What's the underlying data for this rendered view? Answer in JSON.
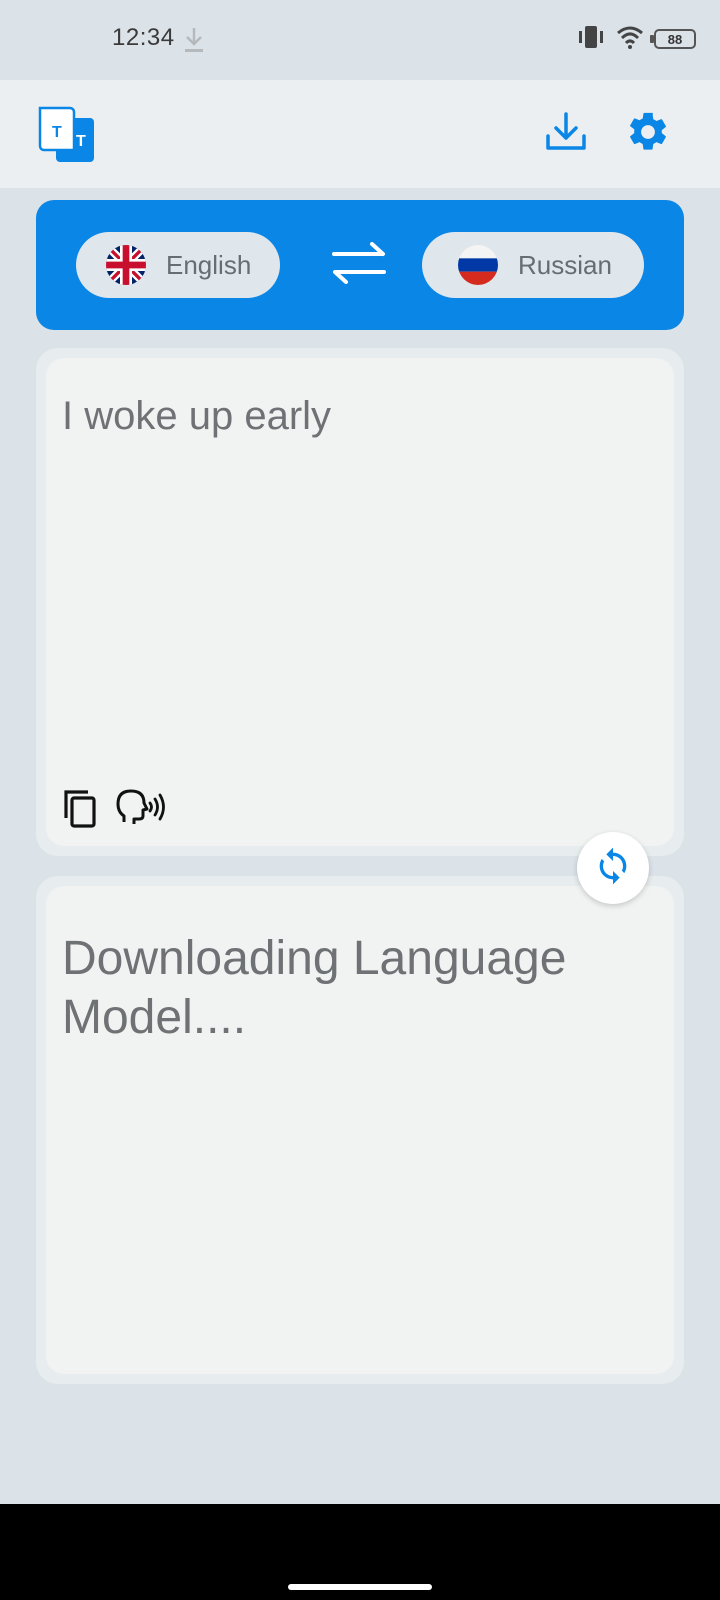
{
  "status_bar": {
    "time": "12:34",
    "battery": "88"
  },
  "toolbar": {
    "download_icon": "download-icon",
    "settings_icon": "gear-icon"
  },
  "languages": {
    "source": "English",
    "target": "Russian",
    "source_flag": "uk-flag",
    "target_flag": "russia-flag"
  },
  "source_panel": {
    "text": "I woke up early"
  },
  "target_panel": {
    "text": "Downloading Language Model...."
  },
  "colors": {
    "accent": "#0a86e6",
    "background": "#dbe2e8",
    "panel": "#f1f3f3"
  }
}
